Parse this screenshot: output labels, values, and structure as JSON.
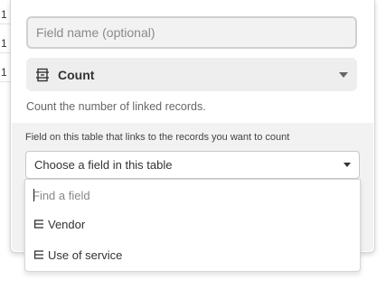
{
  "background_grid": {
    "cells": [
      "1",
      "1",
      "1"
    ]
  },
  "field_config": {
    "name_placeholder": "Field name (optional)",
    "name_value": "",
    "field_type": {
      "label": "Count",
      "icon": "count-icon"
    },
    "type_description": "Count the number of linked records.",
    "link_section": {
      "label": "Field on this table that links to the records you want to count",
      "select_value": "Choose a field in this table"
    }
  },
  "dropdown": {
    "search_placeholder": "Find a field",
    "options": [
      {
        "label": "Vendor",
        "icon": "link-field-icon"
      },
      {
        "label": "Use of service",
        "icon": "link-field-icon"
      }
    ]
  },
  "colors": {
    "panel_bg": "#ffffff",
    "section_bg": "#f2f2f2",
    "input_bg": "#f2f2f2",
    "text": "#333333",
    "muted": "#666666"
  }
}
